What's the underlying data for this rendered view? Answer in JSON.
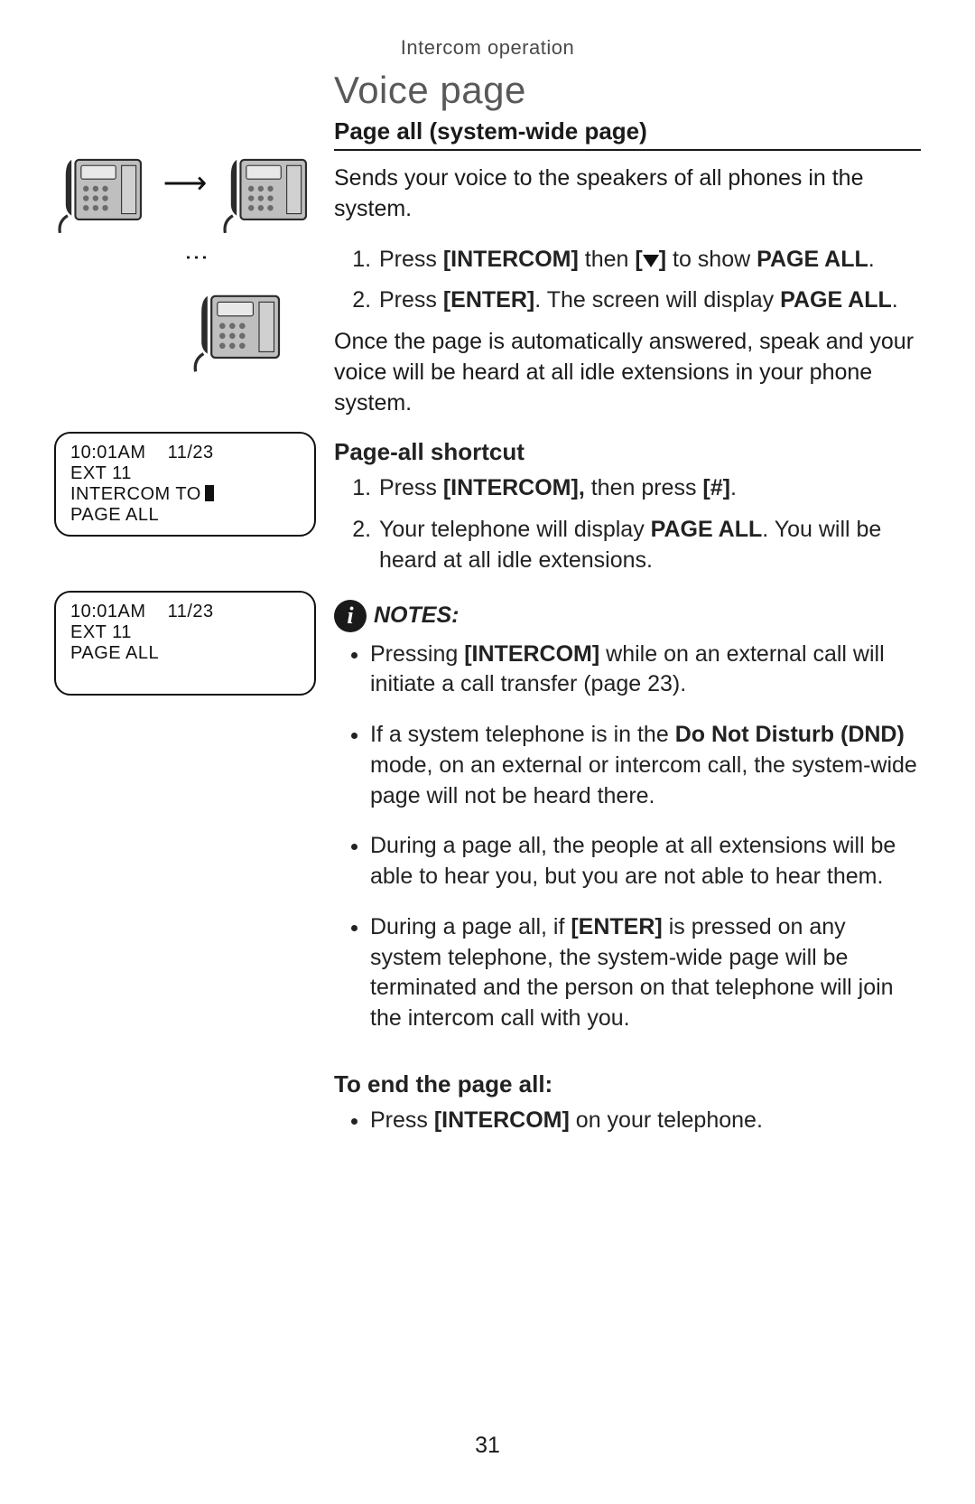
{
  "header": {
    "category": "Intercom operation"
  },
  "title": "Voice page",
  "section1": {
    "heading": "Page all (system-wide page)",
    "intro": "Sends your voice to the speakers of all phones in the system.",
    "step1_a": "Press ",
    "step1_b": "[INTERCOM]",
    "step1_c": " then ",
    "step1_d": " to show ",
    "step1_e": "PAGE ALL",
    "step1_f": ".",
    "step2_a": "Press ",
    "step2_b": "[ENTER]",
    "step2_c": ". The screen will display ",
    "step2_d": "PAGE ALL",
    "step2_e": ".",
    "after": "Once the page is automatically answered, speak and your voice will be heard at all idle extensions in your phone system."
  },
  "section2": {
    "heading": "Page-all shortcut",
    "s1_a": "Press ",
    "s1_b": "[INTERCOM],",
    "s1_c": " then press ",
    "s1_d": "[#]",
    "s1_e": ".",
    "s2_a": "Your telephone will display ",
    "s2_b": "PAGE ALL",
    "s2_c": ". You will be heard at all idle extensions."
  },
  "notes": {
    "label": "NOTES:",
    "n1_a": "Pressing ",
    "n1_b": "[INTERCOM]",
    "n1_c": " while on an external call will initiate a call transfer (page 23).",
    "n2_a": "If a system telephone is in the ",
    "n2_b": "Do Not Disturb (DND)",
    "n2_c": " mode, on an external or intercom call, the system-wide page will not be heard there.",
    "n3": "During a page all, the people at all extensions will be able to hear you, but you are not able to hear them.",
    "n4_a": "During a page all, if ",
    "n4_b": "[ENTER]",
    "n4_c": " is pressed on any system telephone, the system-wide page will be terminated and the person on that telephone will join the intercom call with you."
  },
  "end": {
    "heading": "To end the page all:",
    "b_a": "Press ",
    "b_b": "[INTERCOM]",
    "b_c": " on your telephone."
  },
  "lcd1": {
    "time": "10:01AM",
    "date": "11/23",
    "line2": "EXT 11",
    "line3": "INTERCOM TO",
    "line4": "PAGE ALL"
  },
  "lcd2": {
    "time": "10:01AM",
    "date": "11/23",
    "line2": "EXT 11",
    "line3": "PAGE ALL"
  },
  "page_number": "31"
}
